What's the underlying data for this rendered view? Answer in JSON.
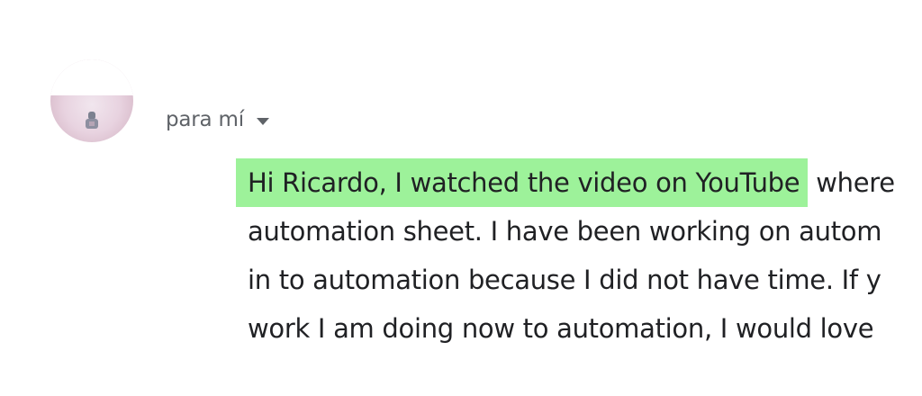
{
  "message": {
    "recipient_label": "para mí",
    "icons": {
      "avatar": "contact-avatar",
      "dropdown": "chevron-down-icon"
    },
    "highlight_color": "#9df29a",
    "text_color": "#202124",
    "secondary_text_color": "#5f6368",
    "highlighted_text": "Hi Ricardo, I watched the video on YouTube",
    "lines": [
      " where",
      "automation sheet. I have been working on autom",
      "in to automation because I did not have time. If y",
      "work I am doing now to automation, I would love"
    ]
  }
}
